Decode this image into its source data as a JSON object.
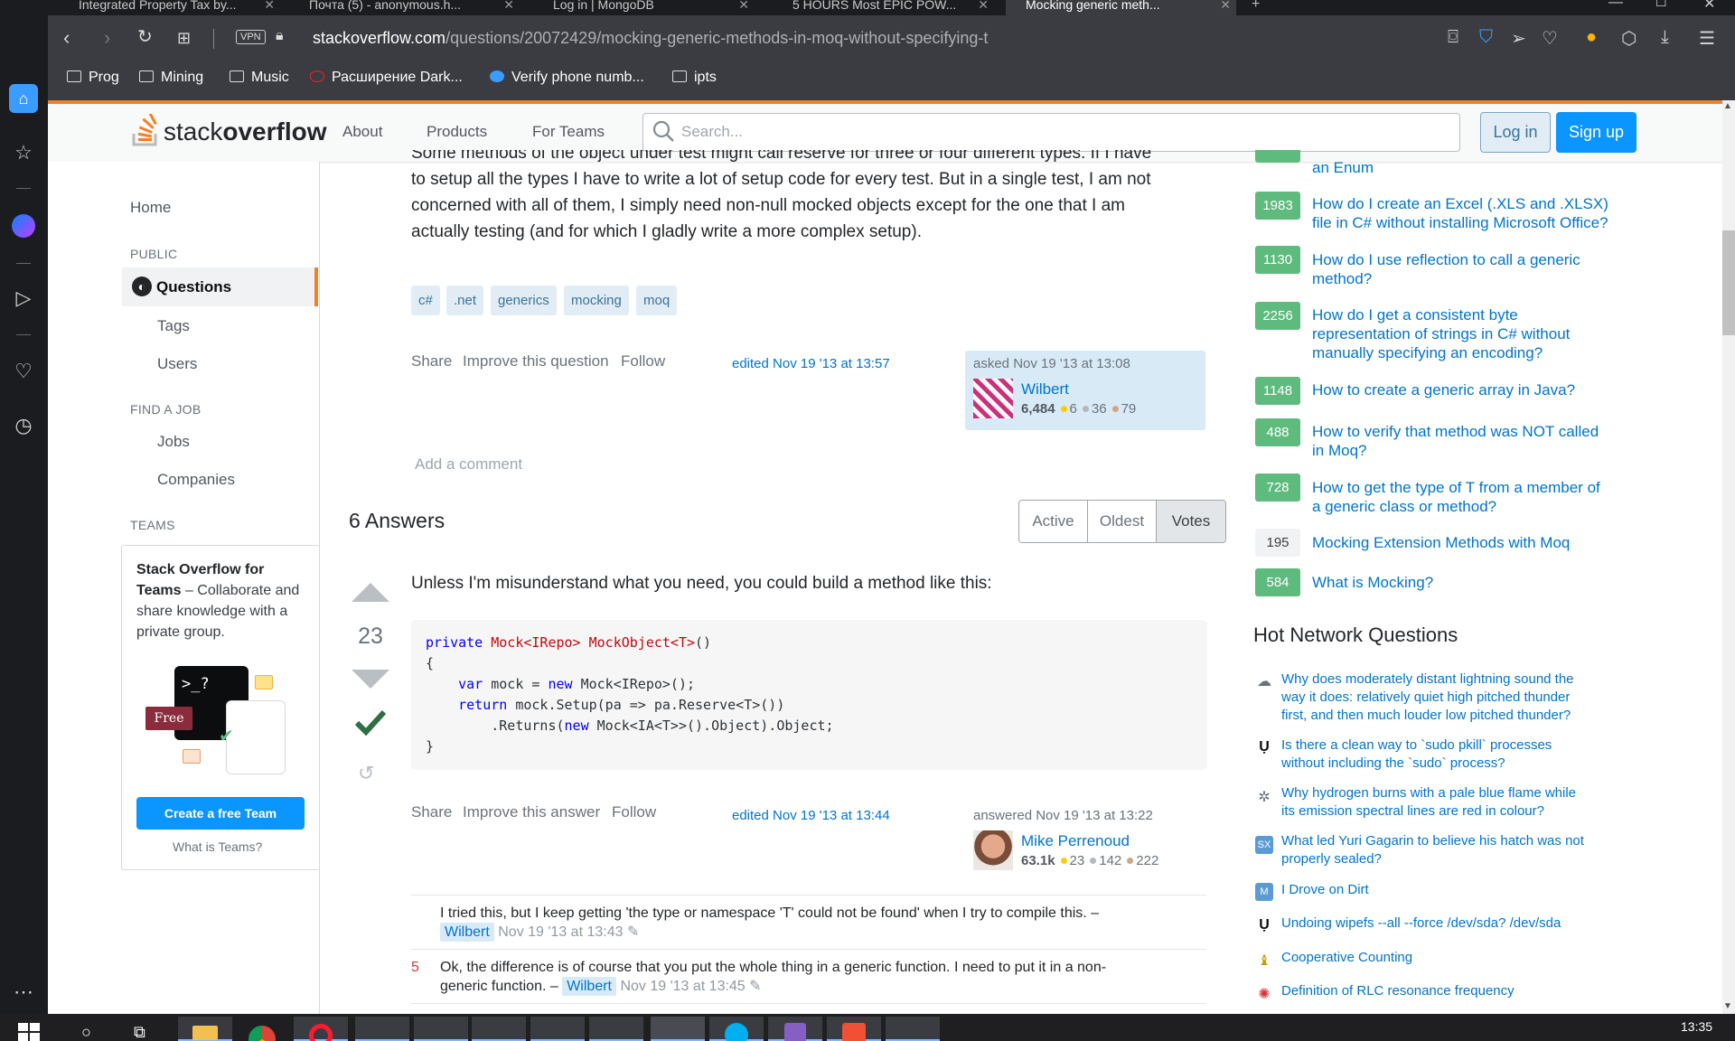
{
  "browser": {
    "tabs": [
      {
        "title": "Integrated Property Tax by..."
      },
      {
        "title": "Почта (5) - anonymous.h..."
      },
      {
        "title": "Log in | MongoDB"
      },
      {
        "title": "5 HOURS Most EPIC POW..."
      },
      {
        "title": "Mocking generic meth..."
      }
    ],
    "url_host": "stackoverflow.com",
    "url_path": "/questions/20072429/mocking-generic-methods-in-moq-without-specifying-t",
    "vpn_label": "VPN",
    "bookmarks": [
      "Prog",
      "Mining",
      "Music",
      "Расширение Dark...",
      "Verify phone numb...",
      "ipts"
    ]
  },
  "so": {
    "logo_light": "stack",
    "logo_bold": "overflow",
    "nav": [
      "About",
      "Products",
      "For Teams"
    ],
    "search_placeholder": "Search...",
    "login": "Log in",
    "signup": "Sign up"
  },
  "leftnav": {
    "home": "Home",
    "public": "PUBLIC",
    "questions": "Questions",
    "tags": "Tags",
    "users": "Users",
    "find_job": "FIND A JOB",
    "jobs": "Jobs",
    "companies": "Companies",
    "teams": "TEAMS",
    "teams_title": "Stack Overflow for Teams",
    "teams_body": " – Collaborate and share knowledge with a private group.",
    "free_label": "Free",
    "prompt": ">_?",
    "create_team": "Create a free Team",
    "what_is_teams": "What is Teams?"
  },
  "question": {
    "para_lines": [
      "Some methods of the object under test might call reserve for three or four different types. If I have",
      "to setup all the types I have to write a lot of setup code for every test. But in a single test, I am not",
      "concerned with all of them, I simply need non-null mocked objects except for the one that I am",
      "actually testing (and for which I gladly write a more complex setup)."
    ],
    "tags": [
      "c#",
      ".net",
      "generics",
      "mocking",
      "moq"
    ],
    "share": "Share",
    "improve": "Improve this question",
    "follow": "Follow",
    "edited": "edited Nov 19 '13 at 13:57",
    "asked": "asked Nov 19 '13 at 13:08",
    "user": "Wilbert",
    "rep": "6,484",
    "gold": "6",
    "silver": "36",
    "bronze": "79",
    "add_comment": "Add a comment"
  },
  "answers": {
    "count_label": "6 Answers",
    "sort": [
      "Active",
      "Oldest",
      "Votes"
    ],
    "selected_sort": "Votes"
  },
  "answer": {
    "votes": "23",
    "text": "Unless I'm misunderstand what you need, you could build a method like this:",
    "code": {
      "l1_kw": "private ",
      "l1_t1": "Mock<IRepo> ",
      "l1_t2": "MockObject<T>",
      "l1_end": "()",
      "l2": "{",
      "l3_kw": "var",
      "l3_a": " mock = ",
      "l3_kw2": "new",
      "l3_b": " Mock<IRepo>();",
      "l4_kw": "return",
      "l4_a": " mock.Setup(pa => pa.Reserve<T>())",
      "l5_a": ".Returns(",
      "l5_kw": "new",
      "l5_b": " Mock<IA<T>>().Object).Object;",
      "l6": "}"
    },
    "share": "Share",
    "improve": "Improve this answer",
    "follow": "Follow",
    "edited": "edited Nov 19 '13 at 13:44",
    "answered": "answered Nov 19 '13 at 13:22",
    "user": "Mike Perrenoud",
    "rep": "63.1k",
    "gold": "23",
    "silver": "142",
    "bronze": "222",
    "comments": [
      {
        "score": "",
        "text": "I tried this, but I keep getting 'the type or namespace 'T' could not be found' when I try to compile this. –",
        "user": "Wilbert",
        "date": "Nov 19 '13 at 13:43"
      },
      {
        "score": "5",
        "text1": "Ok, the difference is of course that you put the whole thing in a generic function. I need to put it in a non-",
        "text2": "generic function. –",
        "user": "Wilbert",
        "date": "Nov 19 '13 at 13:45"
      }
    ]
  },
  "related": [
    {
      "votes": "",
      "title2": "an Enum"
    },
    {
      "votes": "1983",
      "title1": "How do I create an Excel (.XLS and .XLSX)",
      "title2": "file in C# without installing Microsoft Office?"
    },
    {
      "votes": "1130",
      "title1": "How do I use reflection to call a generic",
      "title2": "method?"
    },
    {
      "votes": "2256",
      "title1": "How do I get a consistent byte",
      "title2": "representation of strings in C# without",
      "title3": "manually specifying an encoding?"
    },
    {
      "votes": "1148",
      "title1": "How to create a generic array in Java?"
    },
    {
      "votes": "488",
      "title1": "How to verify that method was NOT called",
      "title2": "in Moq?"
    },
    {
      "votes": "728",
      "title1": "How to get the type of T from a member of",
      "title2": "a generic class or method?"
    },
    {
      "votes": "195",
      "title1": "Mocking Extension Methods with Moq"
    },
    {
      "votes": "584",
      "title1": "What is Mocking?"
    }
  ],
  "hnq": {
    "title": "Hot Network Questions",
    "items": [
      {
        "l1": "Why does moderately distant lightning sound the",
        "l2": "way it does: relatively quiet high pitched thunder",
        "l3": "first, and then much louder low pitched thunder?"
      },
      {
        "l1": "Is there a clean way to `sudo pkill` processes",
        "l2": "without including the `sudo` process?"
      },
      {
        "l1": "Why hydrogen burns with a pale blue flame while",
        "l2": "its emission spectral lines are red in colour?"
      },
      {
        "l1": "What led Yuri Gagarin to believe his hatch was not",
        "l2": "properly sealed?"
      },
      {
        "l1": "I Drove on Dirt"
      },
      {
        "l1": "Undoing wipefs --all --force /dev/sda? /dev/sda"
      },
      {
        "l1": "Cooperative Counting"
      },
      {
        "l1": "Definition of RLC resonance frequency"
      }
    ]
  },
  "taskbar": {
    "clock": "13:35"
  },
  "colors": {
    "accent": "#f48024",
    "link": "#0074cc",
    "green": "#5eba7d"
  }
}
